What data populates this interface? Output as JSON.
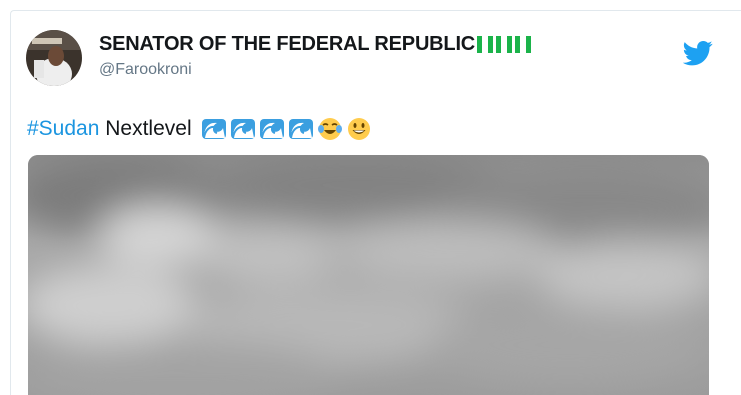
{
  "author": {
    "name": "SENATOR OF THE FEDERAL REPUBLIC",
    "flag_emojis": [
      "nigeria-flag",
      "nigeria-flag",
      "nigeria-flag"
    ],
    "handle": "@Farookroni"
  },
  "tweet": {
    "hashtag": "#Sudan",
    "text": " Nextlevel",
    "emojis": [
      "water-wave",
      "water-wave",
      "water-wave",
      "water-wave",
      "face-with-tears-of-joy",
      "grinning-face"
    ]
  },
  "colors": {
    "hashtag": "#1b95e0",
    "twitter_blue": "#1da1f2",
    "text": "#14171a",
    "secondary": "#657786"
  }
}
